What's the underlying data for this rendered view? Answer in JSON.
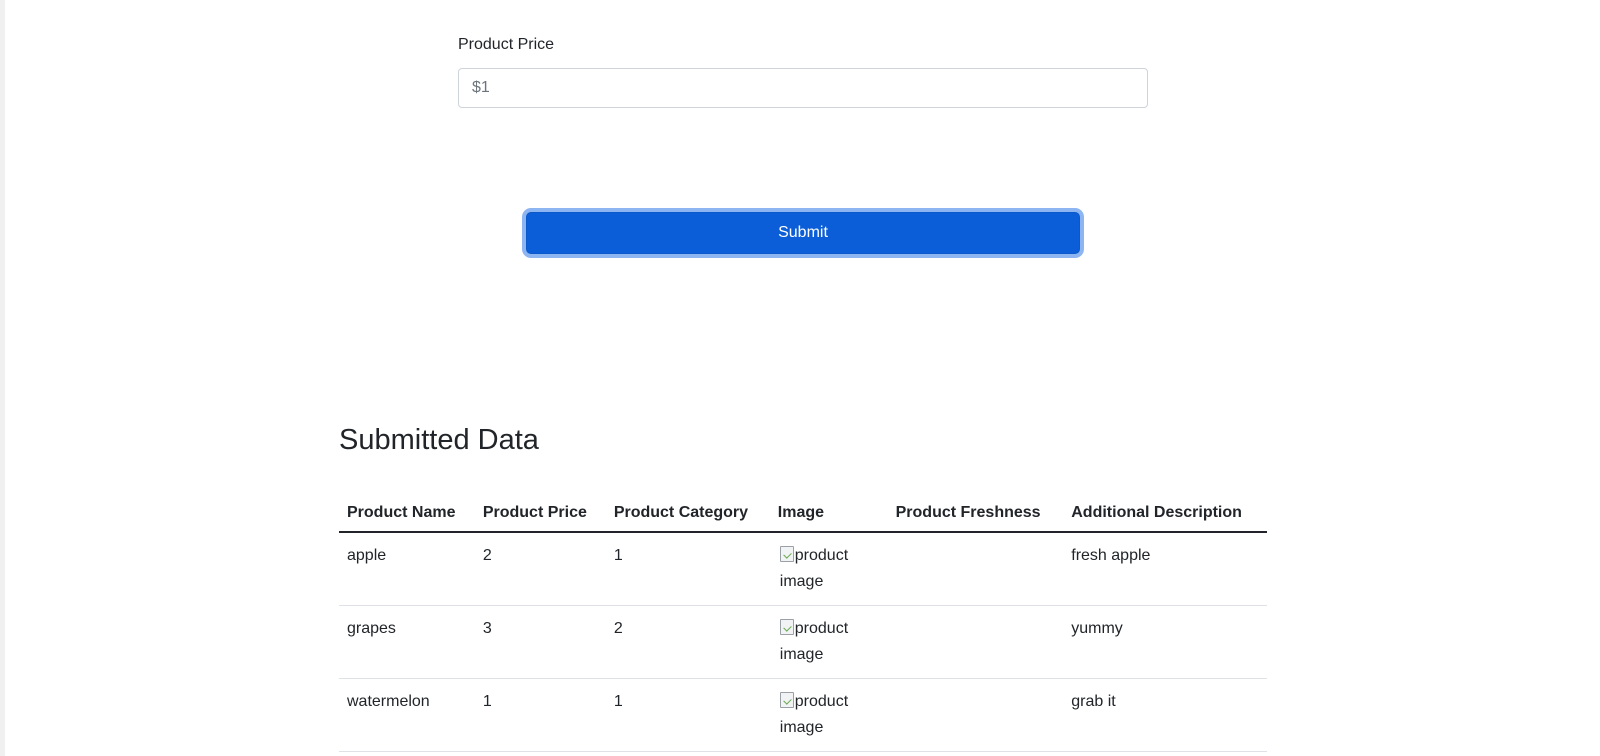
{
  "form": {
    "price_label": "Product Price",
    "price_value": "",
    "price_placeholder": "$1",
    "submit_label": "Submit"
  },
  "submitted": {
    "title": "Submitted Data",
    "columns": [
      "Product Name",
      "Product Price",
      "Product Category",
      "Image",
      "Product Freshness",
      "Additional Description"
    ],
    "rows": [
      {
        "name": "apple",
        "price": "2",
        "category": "1",
        "image_alt": "product image",
        "freshness": "",
        "description": "fresh apple"
      },
      {
        "name": "grapes",
        "price": "3",
        "category": "2",
        "image_alt": "product image",
        "freshness": "",
        "description": "yummy"
      },
      {
        "name": "watermelon",
        "price": "1",
        "category": "1",
        "image_alt": "product image",
        "freshness": "",
        "description": "grab it"
      }
    ]
  },
  "colors": {
    "primary_button": "#0b5ed7",
    "button_focus_ring": "#8db5f2",
    "text": "#212529",
    "placeholder": "#6c757d",
    "row_divider": "#dee2e6"
  },
  "icons": {
    "broken_image": "broken-image-icon"
  }
}
